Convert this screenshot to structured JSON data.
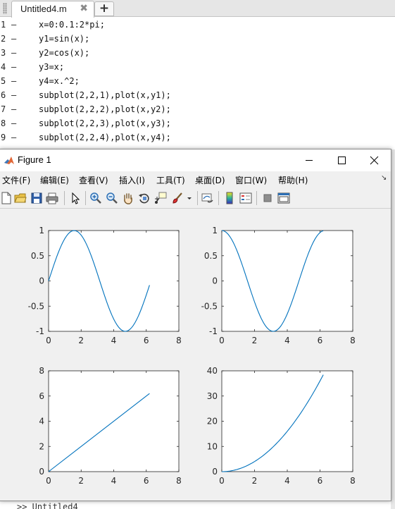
{
  "editor": {
    "tab_label": "Untitled4.m",
    "tab_close": "✖",
    "tab_add": "+",
    "lines": [
      {
        "num": "1",
        "dash": "—",
        "code": "x=0:0.1:2*pi;"
      },
      {
        "num": "2",
        "dash": "—",
        "code": "y1=sin(x);"
      },
      {
        "num": "3",
        "dash": "—",
        "code": "y2=cos(x);"
      },
      {
        "num": "4",
        "dash": "—",
        "code": "y3=x;"
      },
      {
        "num": "5",
        "dash": "—",
        "code": "y4=x.^2;"
      },
      {
        "num": "6",
        "dash": "—",
        "code": "subplot(2,2,1),plot(x,y1);"
      },
      {
        "num": "7",
        "dash": "—",
        "code": "subplot(2,2,2),plot(x,y2);"
      },
      {
        "num": "8",
        "dash": "—",
        "code": "subplot(2,2,3),plot(x,y3);"
      },
      {
        "num": "9",
        "dash": "—",
        "code": "subplot(2,2,4),plot(x,y4);"
      }
    ],
    "command_peek": ">> Untitled4"
  },
  "figure": {
    "title": "Figure 1",
    "menus": [
      "文件(F)",
      "编辑(E)",
      "查看(V)",
      "插入(I)",
      "工具(T)",
      "桌面(D)",
      "窗口(W)",
      "帮助(H)"
    ],
    "menu_overflow": "↘"
  },
  "toolbar_icons": [
    "new-file-icon",
    "open-folder-icon",
    "save-icon",
    "print-icon",
    "pointer-icon",
    "zoom-in-icon",
    "zoom-out-icon",
    "pan-hand-icon",
    "rotate-3d-icon",
    "data-cursor-icon",
    "brush-icon",
    "brush-dropdown-icon",
    "link-plot-icon",
    "colorbar-icon",
    "legend-icon",
    "hide-plot-tools-icon",
    "show-plot-tools-icon"
  ],
  "colors": {
    "line": "#0072bd",
    "accent_title": "#ffffff",
    "canvas": "#f0f0f0"
  },
  "chart_data": [
    {
      "type": "line",
      "title": "",
      "xlabel": "",
      "ylabel": "",
      "xlim": [
        0,
        8
      ],
      "ylim": [
        -1,
        1
      ],
      "xticks": [
        "0",
        "2",
        "4",
        "6",
        "8"
      ],
      "yticks": [
        "-1",
        "-0.5",
        "0",
        "0.5",
        "1"
      ],
      "series": [
        {
          "function": "sin(x)",
          "x": [
            0,
            0.5,
            1,
            1.5,
            2,
            2.5,
            3,
            3.5,
            4,
            4.5,
            5,
            5.5,
            6,
            6.2
          ],
          "y": [
            0,
            0.479,
            0.841,
            0.997,
            0.909,
            0.598,
            0.141,
            -0.351,
            -0.757,
            -0.978,
            -0.959,
            -0.706,
            -0.279,
            -0.083
          ]
        }
      ]
    },
    {
      "type": "line",
      "title": "",
      "xlabel": "",
      "ylabel": "",
      "xlim": [
        0,
        8
      ],
      "ylim": [
        -1,
        1
      ],
      "xticks": [
        "0",
        "2",
        "4",
        "6",
        "8"
      ],
      "yticks": [
        "-1",
        "-0.5",
        "0",
        "0.5",
        "1"
      ],
      "series": [
        {
          "function": "cos(x)",
          "x": [
            0,
            0.5,
            1,
            1.5,
            2,
            2.5,
            3,
            3.5,
            4,
            4.5,
            5,
            5.5,
            6,
            6.2
          ],
          "y": [
            1,
            0.878,
            0.54,
            0.071,
            -0.416,
            -0.801,
            -0.99,
            -0.936,
            -0.654,
            -0.211,
            0.284,
            0.709,
            0.96,
            0.997
          ]
        }
      ]
    },
    {
      "type": "line",
      "title": "",
      "xlabel": "",
      "ylabel": "",
      "xlim": [
        0,
        8
      ],
      "ylim": [
        0,
        8
      ],
      "xticks": [
        "0",
        "2",
        "4",
        "6",
        "8"
      ],
      "yticks": [
        "0",
        "2",
        "4",
        "6",
        "8"
      ],
      "series": [
        {
          "function": "x",
          "x": [
            0,
            6.2
          ],
          "y": [
            0,
            6.2
          ]
        }
      ]
    },
    {
      "type": "line",
      "title": "",
      "xlabel": "",
      "ylabel": "",
      "xlim": [
        0,
        8
      ],
      "ylim": [
        0,
        40
      ],
      "xticks": [
        "0",
        "2",
        "4",
        "6",
        "8"
      ],
      "yticks": [
        "0",
        "10",
        "20",
        "30",
        "40"
      ],
      "series": [
        {
          "function": "x.^2",
          "x": [
            0,
            0.5,
            1,
            1.5,
            2,
            2.5,
            3,
            3.5,
            4,
            4.5,
            5,
            5.5,
            6,
            6.2
          ],
          "y": [
            0,
            0.25,
            1,
            2.25,
            4,
            6.25,
            9,
            12.25,
            16,
            20.25,
            25,
            30.25,
            36,
            38.44
          ]
        }
      ]
    }
  ]
}
